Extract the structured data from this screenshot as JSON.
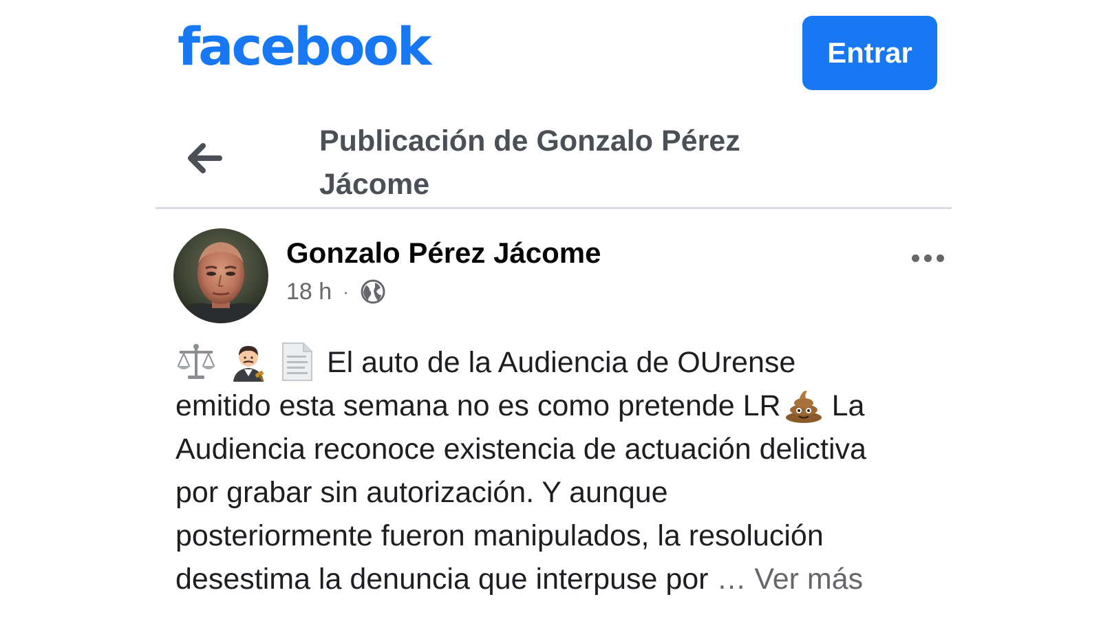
{
  "header": {
    "logo_text": "facebook",
    "login_label": "Entrar",
    "brand_color": "#1877f2"
  },
  "nav": {
    "back_icon": "arrow-left-icon",
    "title_line1": "Publicación de Gonzalo Pérez",
    "title_line2": "Jácome"
  },
  "post": {
    "author": "Gonzalo Pérez Jácome",
    "time": "18 h",
    "separator": "·",
    "audience_icon": "globe-icon",
    "more_icon": "more-options-icon",
    "emojis": [
      "scales-icon",
      "judge-emoji",
      "document-icon",
      "pile-of-poo-emoji"
    ],
    "text_lines": [
      "El auto de la Audiencia de OUrense",
      "emitido esta semana no es como pretende LR",
      "La",
      "Audiencia reconoce existencia de actuación delictiva",
      "por grabar sin autorización. Y aunque",
      "posteriormente fueron manipulados, la resolución",
      "desestima la denuncia que interpuse por"
    ],
    "ellipsis": "…",
    "see_more": "Ver más"
  }
}
